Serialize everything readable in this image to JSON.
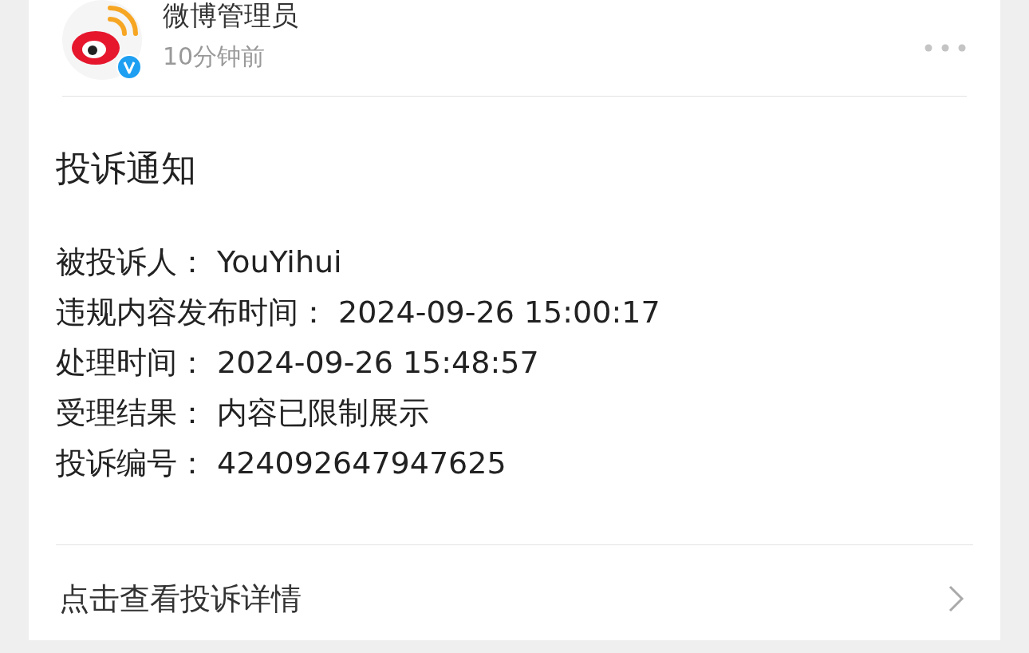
{
  "header": {
    "name": "微博管理员",
    "time": "10分钟前",
    "verified": true
  },
  "title": "投诉通知",
  "fields": [
    {
      "label": "被投诉人：",
      "value": "YouYihui"
    },
    {
      "label": "违规内容发布时间：",
      "value": "2024-09-26 15:00:17"
    },
    {
      "label": "处理时间：",
      "value": "2024-09-26 15:48:57"
    },
    {
      "label": "受理结果：",
      "value": "内容已限制展示"
    },
    {
      "label": "投诉编号：",
      "value": "424092647947625"
    }
  ],
  "link": {
    "text": "点击查看投诉详情"
  }
}
